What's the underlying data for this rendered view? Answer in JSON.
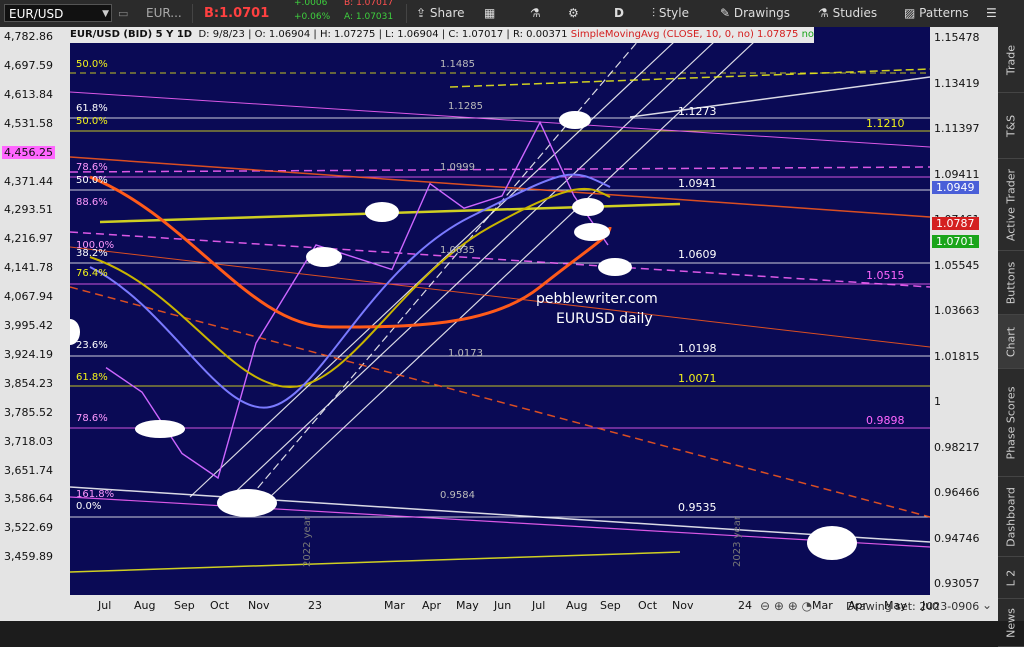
{
  "toolbar": {
    "symbol": "EUR/USD",
    "tab2": "EUR...",
    "bid_label": "B:",
    "bid": "1.0701",
    "change": "+.0006",
    "change_pct": "+0.06%",
    "bid2": "B: 1.07017",
    "ask2": "A: 1.07031",
    "share": "Share",
    "period": "D",
    "style": "Style",
    "drawings": "Drawings",
    "studies": "Studies",
    "patterns": "Patterns"
  },
  "header": {
    "symbol": "EUR/USD (BID) 5 Y 1D",
    "date": "D: 9/8/23",
    "open": "O: 1.06904",
    "high": "H: 1.07275",
    "low": "L: 1.06904",
    "close": "C: 1.07017",
    "range": "R: 0.00371",
    "study": "SimpleMovingAvg (CLOSE, 10, 0, no)",
    "study_val": "1.07875",
    "extra": "no"
  },
  "side_tabs": [
    "Trade",
    "T&S",
    "Active Trader",
    "Buttons",
    "Chart",
    "Phase Scores",
    "Dashboard",
    "L 2",
    "News"
  ],
  "left_axis": [
    "4,782.86",
    "4,697.59",
    "4,613.84",
    "4,531.58",
    "4,456.25",
    "4,371.44",
    "4,293.51",
    "4,216.97",
    "4,141.78",
    "4,067.94",
    "3,995.42",
    "3,924.19",
    "3,854.23",
    "3,785.52",
    "3,718.03",
    "3,651.74",
    "3,586.64",
    "3,522.69",
    "3,459.89"
  ],
  "left_highlight": "4,456.25",
  "right_axis": [
    "1.15478",
    "1.13419",
    "1.11397",
    "1.09411",
    "1.07461",
    "1.05545",
    "1.03663",
    "1.01815",
    "1",
    "0.98217",
    "0.96466",
    "0.94746",
    "0.93057"
  ],
  "right_markers": [
    {
      "label": "1.0949",
      "color": "#4a5fd8"
    },
    {
      "label": "1.0787",
      "color": "#d42020"
    },
    {
      "label": "1.0701",
      "color": "#1aa51a"
    }
  ],
  "x_axis": [
    "Jul",
    "Aug",
    "Sep",
    "Oct",
    "Nov",
    "23",
    "Mar",
    "Apr",
    "May",
    "Jun",
    "Jul",
    "Aug",
    "Sep",
    "Oct",
    "Nov",
    "24",
    "Mar",
    "Apr",
    "May",
    "Jun"
  ],
  "year_marks": [
    "2022 year",
    "2023 year"
  ],
  "fib_left": [
    "50.0%",
    "61.8%",
    "50.0%",
    "78.6%",
    "50.0%",
    "88.6%",
    "100.0%",
    "38.2%",
    "76.4%",
    "23.6%",
    "61.8%",
    "78.6%",
    "161.8%",
    "0.0%"
  ],
  "fib_mid": [
    "1.1485",
    "1.1285",
    "1.0999",
    "1.0635",
    "1.0173",
    "0.9584"
  ],
  "fib_right": [
    {
      "label": "1.1273",
      "color": "#ffffff"
    },
    {
      "label": "1.1210",
      "color": "#f2f21a"
    },
    {
      "label": "1.0941",
      "color": "#ffffff"
    },
    {
      "label": "1.0609",
      "color": "#ffffff"
    },
    {
      "label": "1.0515",
      "color": "#ff66ff"
    },
    {
      "label": "1.0198",
      "color": "#ffffff"
    },
    {
      "label": "1.0071",
      "color": "#f2f21a"
    },
    {
      "label": "0.9898",
      "color": "#ff66ff"
    },
    {
      "label": "0.9535",
      "color": "#ffffff"
    }
  ],
  "watermark": [
    "pebblewriter.com",
    "EURUSD daily"
  ],
  "footer": {
    "drawing_set": "Drawing set: 2023-0906"
  },
  "chart_data": {
    "type": "line",
    "title": "EURUSD daily",
    "series": [
      {
        "name": "EUR/USD (BID)",
        "x": [
          "2022-07",
          "2022-08",
          "2022-09",
          "2022-10",
          "2022-11",
          "2023-01",
          "2023-03",
          "2023-04",
          "2023-05",
          "2023-06",
          "2023-07",
          "2023-08",
          "2023-09"
        ],
        "values": [
          1.02,
          1.01,
          0.985,
          0.975,
          1.03,
          1.07,
          1.06,
          1.095,
          1.085,
          1.09,
          1.12,
          1.09,
          1.07
        ]
      }
    ],
    "ylim": [
      0.93057,
      1.15478
    ],
    "colors": {
      "background": "#0a0a55",
      "price": "#cc66ff",
      "sma_red": "#ff5a1a",
      "sma_yellow": "#c8b400",
      "sma_blue": "#7a7aff"
    }
  }
}
